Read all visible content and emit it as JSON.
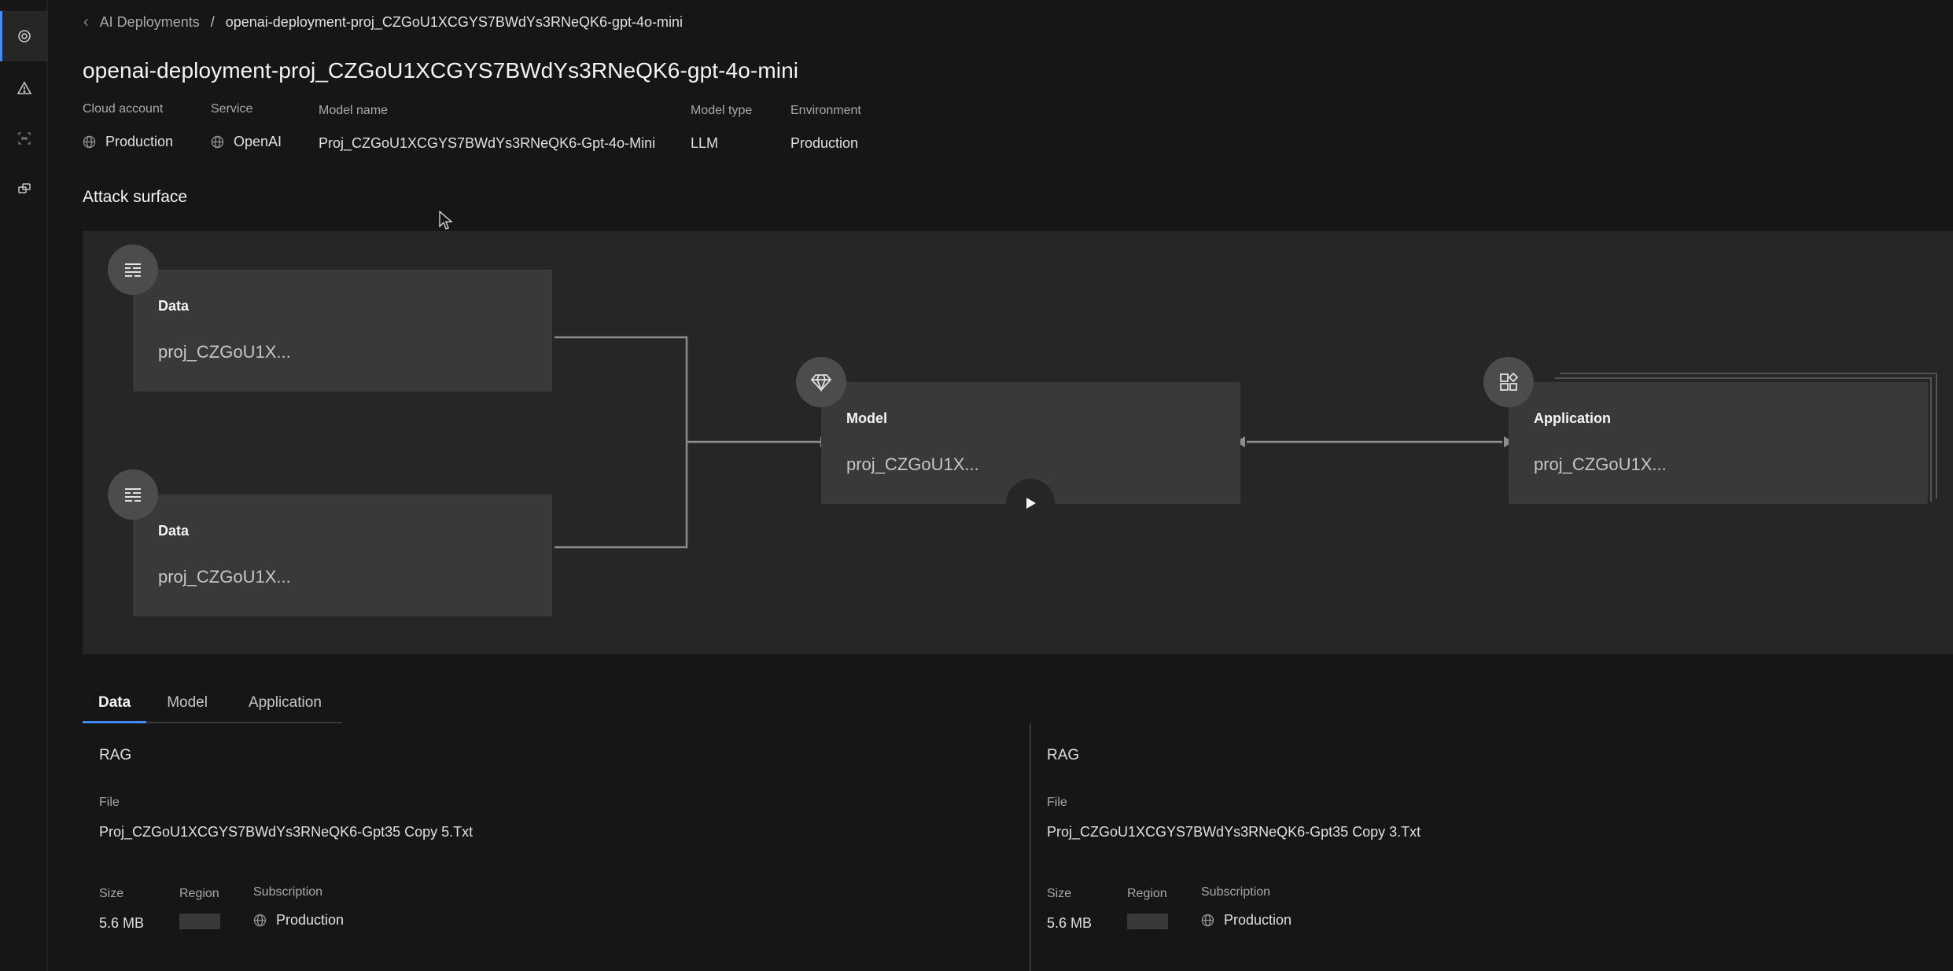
{
  "breadcrumb": {
    "parent": "AI Deployments",
    "separator": "/",
    "current": "openai-deployment-proj_CZGoU1XCGYS7BWdYs3RNeQK6-gpt-4o-mini"
  },
  "page_title": "openai-deployment-proj_CZGoU1XCGYS7BWdYs3RNeQK6-gpt-4o-mini",
  "metadata": {
    "cloud_account": {
      "label": "Cloud account",
      "value": "Production"
    },
    "service": {
      "label": "Service",
      "value": "OpenAI"
    },
    "model_name": {
      "label": "Model name",
      "value": "Proj_CZGoU1XCGYS7BWdYs3RNeQK6-Gpt-4o-Mini"
    },
    "model_type": {
      "label": "Model type",
      "value": "LLM"
    },
    "environment": {
      "label": "Environment",
      "value": "Production"
    }
  },
  "attack_surface": {
    "title": "Attack surface",
    "nodes": {
      "data_1": {
        "type": "Data",
        "name": "proj_CZGoU1X..."
      },
      "data_2": {
        "type": "Data",
        "name": "proj_CZGoU1X..."
      },
      "model": {
        "type": "Model",
        "name": "proj_CZGoU1X..."
      },
      "application": {
        "type": "Application",
        "name": "proj_CZGoU1X..."
      }
    }
  },
  "tabs": [
    {
      "label": "Data",
      "active": true
    },
    {
      "label": "Model",
      "active": false
    },
    {
      "label": "Application",
      "active": false
    }
  ],
  "details": [
    {
      "kind": "RAG",
      "file_label": "File",
      "file_value": "Proj_CZGoU1XCGYS7BWdYs3RNeQK6-Gpt35 Copy 5.Txt",
      "size_label": "Size",
      "size_value": "5.6 MB",
      "region_label": "Region",
      "subscription_label": "Subscription",
      "subscription_value": "Production"
    },
    {
      "kind": "RAG",
      "file_label": "File",
      "file_value": "Proj_CZGoU1XCGYS7BWdYs3RNeQK6-Gpt35 Copy 3.Txt",
      "size_label": "Size",
      "size_value": "5.6 MB",
      "region_label": "Region",
      "subscription_label": "Subscription",
      "subscription_value": "Production"
    }
  ],
  "rail": {
    "items": [
      "settings-icon",
      "warning-icon",
      "scan-icon",
      "connect-icon"
    ]
  },
  "colors": {
    "background": "#161616",
    "canvas": "#262626",
    "node": "#393939",
    "accent": "#4589ff"
  }
}
